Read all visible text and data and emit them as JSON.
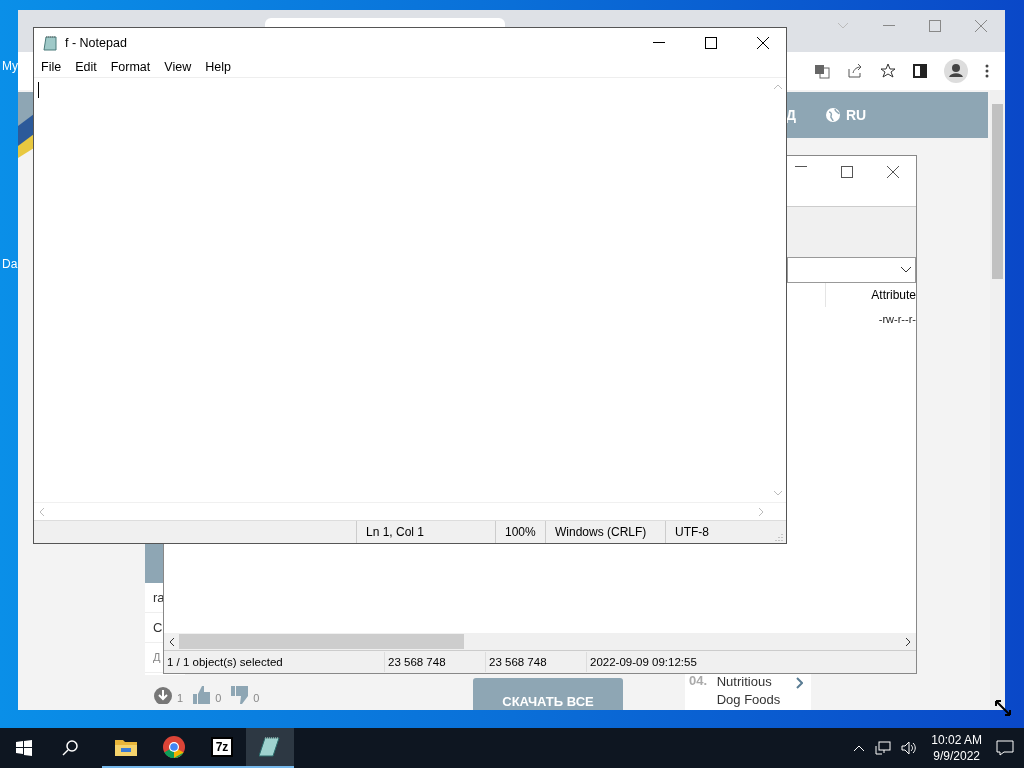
{
  "desktop": {
    "icon_labels": [
      "My",
      "Da"
    ]
  },
  "browser": {
    "header_items": [
      "Д",
      "RU"
    ],
    "card_lines": [
      "ra",
      "C",
      "Д"
    ],
    "counters": [
      {
        "kind": "download",
        "value": "1"
      },
      {
        "kind": "like",
        "value": "0"
      },
      {
        "kind": "dislike",
        "value": "0"
      }
    ],
    "download_button": "СКАЧАТЬ ВСЕ",
    "list_item": {
      "number": "04.",
      "title": "Nutritious Dog Foods"
    }
  },
  "archive_window": {
    "columns": [
      "Attribute"
    ],
    "rows": [
      [
        "-rw-r--r-"
      ]
    ],
    "status_bar": [
      "1 / 1 object(s) selected",
      "23 568 748",
      "23 568 748",
      "2022-09-09 09:12:55"
    ]
  },
  "notepad": {
    "title": "f - Notepad",
    "menu": [
      "File",
      "Edit",
      "Format",
      "View",
      "Help"
    ],
    "status_bar": [
      "Ln 1, Col 1",
      "100%",
      "Windows (CRLF)",
      "UTF-8"
    ]
  },
  "taskbar": {
    "apps": [
      {
        "kind": "folder",
        "selected": false
      },
      {
        "kind": "chrome",
        "selected": false
      },
      {
        "kind": "archiver",
        "label": "7z",
        "selected": false
      },
      {
        "kind": "notepad",
        "selected": true
      }
    ],
    "time": "10:02 AM",
    "date": "9/9/2022"
  }
}
